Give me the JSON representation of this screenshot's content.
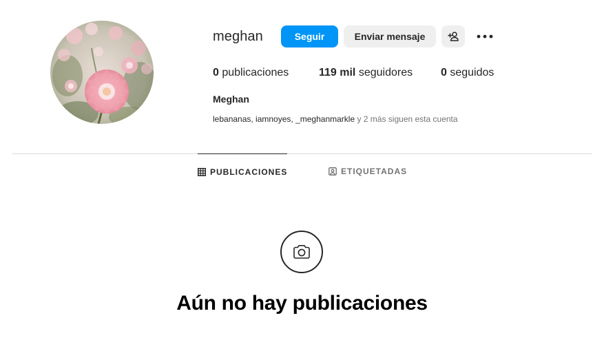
{
  "profile": {
    "username": "meghan",
    "full_name": "Meghan",
    "avatar": "pink-dahlia-flower-photo"
  },
  "actions": {
    "follow_label": "Seguir",
    "message_label": "Enviar mensaje",
    "suggest_icon": "add-person-icon",
    "more_icon": "ellipsis-icon"
  },
  "stats": {
    "posts_count": "0",
    "posts_label": " publicaciones",
    "followers_count": "119 mil",
    "followers_label": " seguidores",
    "following_count": "0",
    "following_label": " seguidos"
  },
  "followed_by": {
    "names": "lebananas, iamnoyes, _meghanmarkle",
    "rest": " y 2 más siguen esta cuenta"
  },
  "tabs": [
    {
      "label": "PUBLICACIONES",
      "icon": "grid-icon",
      "active": true
    },
    {
      "label": "ETIQUETADAS",
      "icon": "tagged-icon",
      "active": false
    }
  ],
  "empty_state": {
    "icon": "camera-icon",
    "title": "Aún no hay publicaciones"
  },
  "colors": {
    "accent": "#0095f6",
    "secondary_button": "#efefef",
    "text": "#262626",
    "muted": "#737373",
    "divider": "#dbdbdb"
  }
}
